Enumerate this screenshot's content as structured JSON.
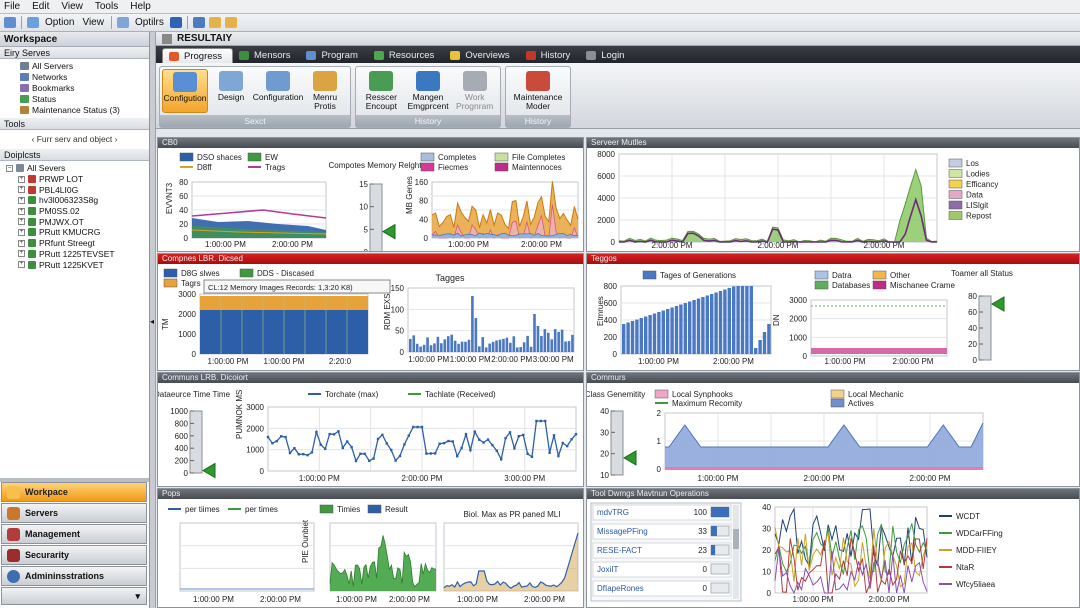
{
  "menu": [
    "File",
    "Edit",
    "View",
    "Tools",
    "Help"
  ],
  "toolbar": {
    "option": "Option",
    "view": "View",
    "optilrs": "Optilrs"
  },
  "sidebar": {
    "header": "Workspace",
    "section1": "Eiry Serves",
    "nav": [
      "All Servers",
      "Networks",
      "Bookmarks",
      "Status",
      "Maintenance Status (3)"
    ],
    "tools_header": "Tools",
    "tools_hint": "‹ Furr serv and object ›",
    "tree_header": "Doiplcsts",
    "tree_root": "All Severs",
    "tree": [
      "PRWP LOT",
      "PBL4LI0G",
      "hv3l006323S8g",
      "PM0SS.02",
      "PMJWX.OT",
      "PRutt KMUCRG",
      "PRfunt Streegt",
      "PRutt 1225TEVSET",
      "PRutt 1225KVET"
    ],
    "buttons": [
      "Workpace",
      "Servers",
      "Management",
      "Securarity",
      "Admininsstrations"
    ]
  },
  "app_title": "RESULTAIY",
  "tabs": [
    "Progress",
    "Mensors",
    "Program",
    "Resources",
    "Overviews",
    "History",
    "Login"
  ],
  "ribbon": {
    "groups": [
      {
        "label": "Sexct",
        "buttons": [
          "Configution",
          "Design",
          "Configuration",
          "Menru Protis"
        ]
      },
      {
        "label": "History",
        "buttons": [
          "Resscer Encoupt",
          "Mangen Emgprcent",
          "Work Prognram"
        ]
      },
      {
        "label": "History",
        "buttons": [
          "Maintenance Moder"
        ]
      }
    ]
  },
  "colors": {
    "accent": "#f29a14",
    "panel_header": "#4c5157",
    "alert_header": "#c01515",
    "blue": "#3c6aa8",
    "green": "#3f9a3f",
    "orange": "#e8a23a",
    "purple": "#9b3a9b"
  },
  "panels": {
    "p1": {
      "title": "CB0",
      "legend": [
        "DSO shaces",
        "EW",
        "D8ff",
        "Trags"
      ],
      "ylabel": "EVVNT3",
      "y_ticks": [
        "80",
        "60",
        "40",
        "20",
        "0"
      ],
      "x_ticks": [
        "1:00:00 PM",
        "2:00:00 PM"
      ],
      "gauge_title": "Compotes Memory Relght",
      "gauge_ticks": [
        "15",
        "10",
        "5",
        "0"
      ],
      "gauge_value": 4.5,
      "chart2_legend": [
        "Completes",
        "Fiecmes",
        "File Completes",
        "Maintennoces"
      ],
      "chart2_ylabel": "MB Genes",
      "chart2_ticks": [
        "160",
        "80",
        "40",
        "0"
      ],
      "chart2_x": [
        "1:00:00 PM",
        "2:00:00 PM"
      ]
    },
    "p2": {
      "title": "Serveer Mutlles",
      "y_ticks": [
        "8000",
        "6000",
        "4000",
        "2000",
        "0"
      ],
      "x_ticks": [
        "2:00:00 PM",
        "2:00:00 PM",
        "2:00:00 PM"
      ],
      "legend": [
        "Los",
        "Lodies",
        "Efficancy",
        "Data",
        "LISlgit",
        "Repost"
      ]
    },
    "p3": {
      "title": "Compnes    LBR. Dicsed",
      "legend": [
        "D8G slwes",
        "DDS - Discased",
        "Tagrs"
      ],
      "ylabel": "TM",
      "y_ticks": [
        "3000",
        "2000",
        "1000",
        "0"
      ],
      "x_ticks": [
        "1:00:00 PM",
        "1:00:00 PM",
        "2:20:0"
      ],
      "tooltip": "CL:12 Memory Images Records: 1,3:20 K8)",
      "chart2_title": "Tagges",
      "chart2_ylabel": "RDM EXS",
      "chart2_ticks": [
        "150",
        "100",
        "50",
        "0"
      ],
      "chart2_x": [
        "1:00:00 PM",
        "1:00:00 PM",
        "2:00:00 PM",
        "3:00:00 PM"
      ]
    },
    "p4": {
      "title": "Teggos",
      "legend": [
        "Tages of Generations"
      ],
      "ylabel": "Etmrues",
      "y_ticks": [
        "800",
        "600",
        "400",
        "200",
        "0"
      ],
      "x_ticks": [
        "1:00:00 PM",
        "2:00:00 PM"
      ],
      "chart2_legend": [
        "Datra",
        "Other",
        "Databases",
        "Mischanee Crame"
      ],
      "chart2_ylabel": "DN",
      "chart2_ticks": [
        "3000",
        "2000",
        "1000",
        "0"
      ],
      "chart2_x": [
        "1:00:00 PM",
        "2:00:00 PM"
      ],
      "gauge_title": "Toamer all Status",
      "gauge_ticks": [
        "80",
        "60",
        "40",
        "20",
        "0"
      ],
      "gauge_value": 70
    },
    "p5": {
      "title": "Communs    LRB. Dicoiort",
      "gauge_title": "Dataeurce Time Time",
      "gauge_ticks": [
        "1000",
        "800",
        "600",
        "400",
        "200",
        "0"
      ],
      "gauge_value": 40,
      "legend": [
        "Torchate (max)",
        "Tachlate (Received)"
      ],
      "ylabel": "PUMNOK MS",
      "y_ticks": [
        "3000",
        "2000",
        "1000",
        "0"
      ],
      "x_ticks": [
        "1:00:00 PM",
        "2:00:00 PM",
        "3:00:00 PM"
      ]
    },
    "p6": {
      "title": "Commurs",
      "gauge_title": "Class Genemitity",
      "gauge_ticks": [
        "40",
        "30",
        "20",
        "10"
      ],
      "gauge_value": 12,
      "legend": [
        "Local Synphooks",
        "Maximum Recomity",
        "Local Mechanic",
        "Actives"
      ],
      "y_ticks": [
        "2",
        "1",
        "0"
      ],
      "x_ticks": [
        "1:00:00 PM",
        "2:00:00 PM",
        "2:00:00 PM"
      ]
    },
    "p7": {
      "title": "Pops",
      "legend": [
        "per tiimes",
        "per times"
      ],
      "x_ticks": [
        "1:00:00 PM",
        "2:00:00 PM"
      ],
      "chart2_legend": [
        "Timies",
        "Result"
      ],
      "chart2_ylabel": "PIE Ounbiet",
      "chart2_x": [
        "1:00:00 PM",
        "2:00:00 PM"
      ],
      "chart3_title": "Biol. Max as PR paned MLI",
      "chart3_x": [
        "1:00:00 PM",
        "2:00:00 PM"
      ]
    },
    "p8": {
      "title": "Tool Dwmgs    Mavtnun Operations",
      "rows": [
        {
          "name": "mdvTRG",
          "value": "100",
          "pct": 1.0
        },
        {
          "name": "MissagePFing",
          "value": "33",
          "pct": 0.33
        },
        {
          "name": "RESE-FACT",
          "value": "23",
          "pct": 0.23
        },
        {
          "name": "JoxiIT",
          "value": "0",
          "pct": 0
        },
        {
          "name": "DfIapeRones",
          "value": "0",
          "pct": 0
        }
      ],
      "y_ticks": [
        "40",
        "30",
        "20",
        "10",
        "0"
      ],
      "x_ticks": [
        "1:00:00 PM",
        "2:00:00 PM"
      ],
      "legend": [
        "WCDT",
        "WDCarFFing",
        "MDD-FIIEY",
        "NtaR",
        "Wfcy5liaea"
      ]
    }
  }
}
